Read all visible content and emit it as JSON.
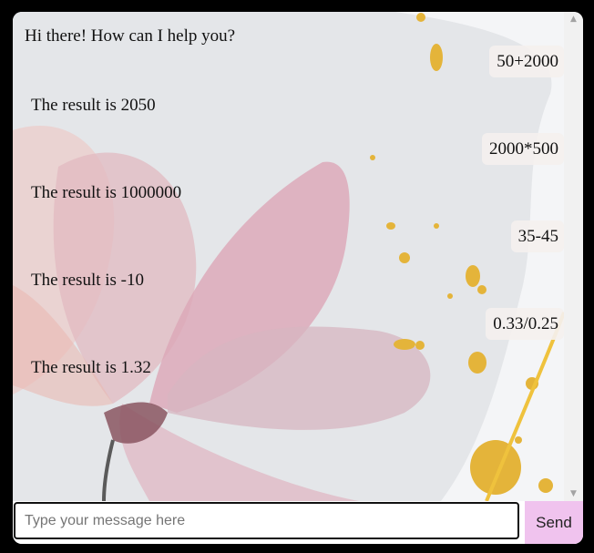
{
  "chat": {
    "messages": [
      {
        "role": "bot",
        "text": "Hi there! How can I help you?"
      },
      {
        "role": "user",
        "text": "50+2000"
      },
      {
        "role": "bot",
        "text": "The result is 2050"
      },
      {
        "role": "user",
        "text": "2000*500"
      },
      {
        "role": "bot",
        "text": "The result is 1000000"
      },
      {
        "role": "user",
        "text": "35-45"
      },
      {
        "role": "bot",
        "text": "The result is -10"
      },
      {
        "role": "user",
        "text": "0.33/0.25"
      },
      {
        "role": "bot",
        "text": "The result is 1.32"
      }
    ]
  },
  "input": {
    "placeholder": "Type your message here",
    "value": ""
  },
  "send_button": {
    "label": "Send"
  },
  "colors": {
    "send_button_bg": "#f0c3ee",
    "flower": "#d9a8b4",
    "gold": "#e4b43a"
  }
}
